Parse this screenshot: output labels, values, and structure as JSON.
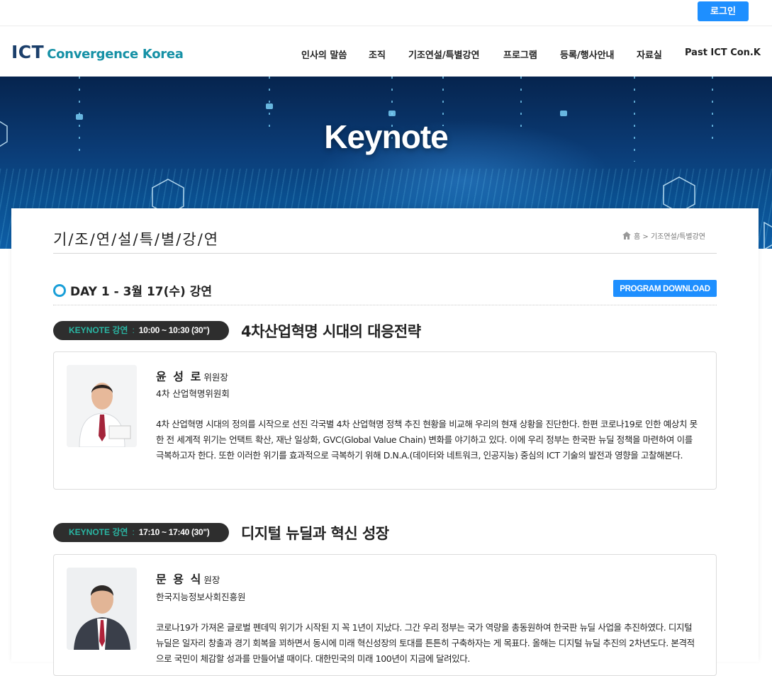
{
  "topbar": {
    "login_label": "로그인"
  },
  "header": {
    "logo": {
      "ict": "ICT",
      "rest": "Convergence Korea"
    },
    "nav": [
      "인사의 말씀",
      "조직",
      "기조연설/특별강연",
      "프로그램",
      "등록/행사안내",
      "자료실",
      "Past ICT Con.K"
    ]
  },
  "hero": {
    "title": "Keynote"
  },
  "page": {
    "title": "기/조/연/설/특/별/강/연",
    "breadcrumb": {
      "home": "홈",
      "current": "> 기조연설/특별강연"
    }
  },
  "day": {
    "heading": "DAY 1 - 3월 17(수) 강연",
    "download_label": "PROGRAM DOWNLOAD"
  },
  "talks": [
    {
      "label": "KEYNOTE 강연",
      "separator": ":",
      "time": "10:00 ~ 10:30 (30\")",
      "title": "4차산업혁명 시대의 대응전략",
      "speaker": {
        "name": "윤 성 로",
        "role": "위원장",
        "org": "4차 산업혁명위원회"
      },
      "description": "4차 산업혁명 시대의 정의를 시작으로 선진 각국별 4차 산업혁명 정책 추진 현황을 비교해 우리의 현재 상황을 진단한다. 한편 코로나19로 인한 예상치 못한 전 세계적 위기는 언택트 확산, 재난 일상화, GVC(Global Value Chain) 변화를 야기하고 있다. 이에 우리 정부는 한국판 뉴딜 정책을 마련하여 이를 극복하고자 한다. 또한 이러한 위기를 효과적으로 극복하기 위해 D.N.A.(데이터와 네트워크, 인공지능) 중심의 ICT 기술의 발전과 영향을 고찰해본다."
    },
    {
      "label": "KEYNOTE 강연",
      "separator": ":",
      "time": "17:10 ~ 17:40 (30\")",
      "title": "디지털 뉴딜과 혁신 성장",
      "speaker": {
        "name": "문 용 식",
        "role": "원장",
        "org": "한국지능정보사회진흥원"
      },
      "description": "코로나19가 가져온 글로벌 펜데믹 위기가 시작된 지 꼭 1년이 지났다. 그간 우리 정부는 국가 역량을 총동원하여 한국판 뉴딜 사업을 추진하였다. 디지털 뉴딜은 일자리 창출과 경기 회복을 꾀하면서 동시에 미래 혁신성장의 토대를 튼튼히 구축하자는 게 목표다. 올해는 디지털 뉴딜 추진의 2차년도다. 본격적으로 국민이 체감할 성과를 만들어낼 때이다. 대한민국의 미래 100년이 지금에 달려있다."
    }
  ],
  "colors": {
    "accent_blue": "#1e8fff",
    "keynote_teal": "#2ab6a3",
    "pill_dark": "#2e2e2e",
    "logo_navy": "#1b3f6b",
    "logo_teal": "#1691a6"
  }
}
